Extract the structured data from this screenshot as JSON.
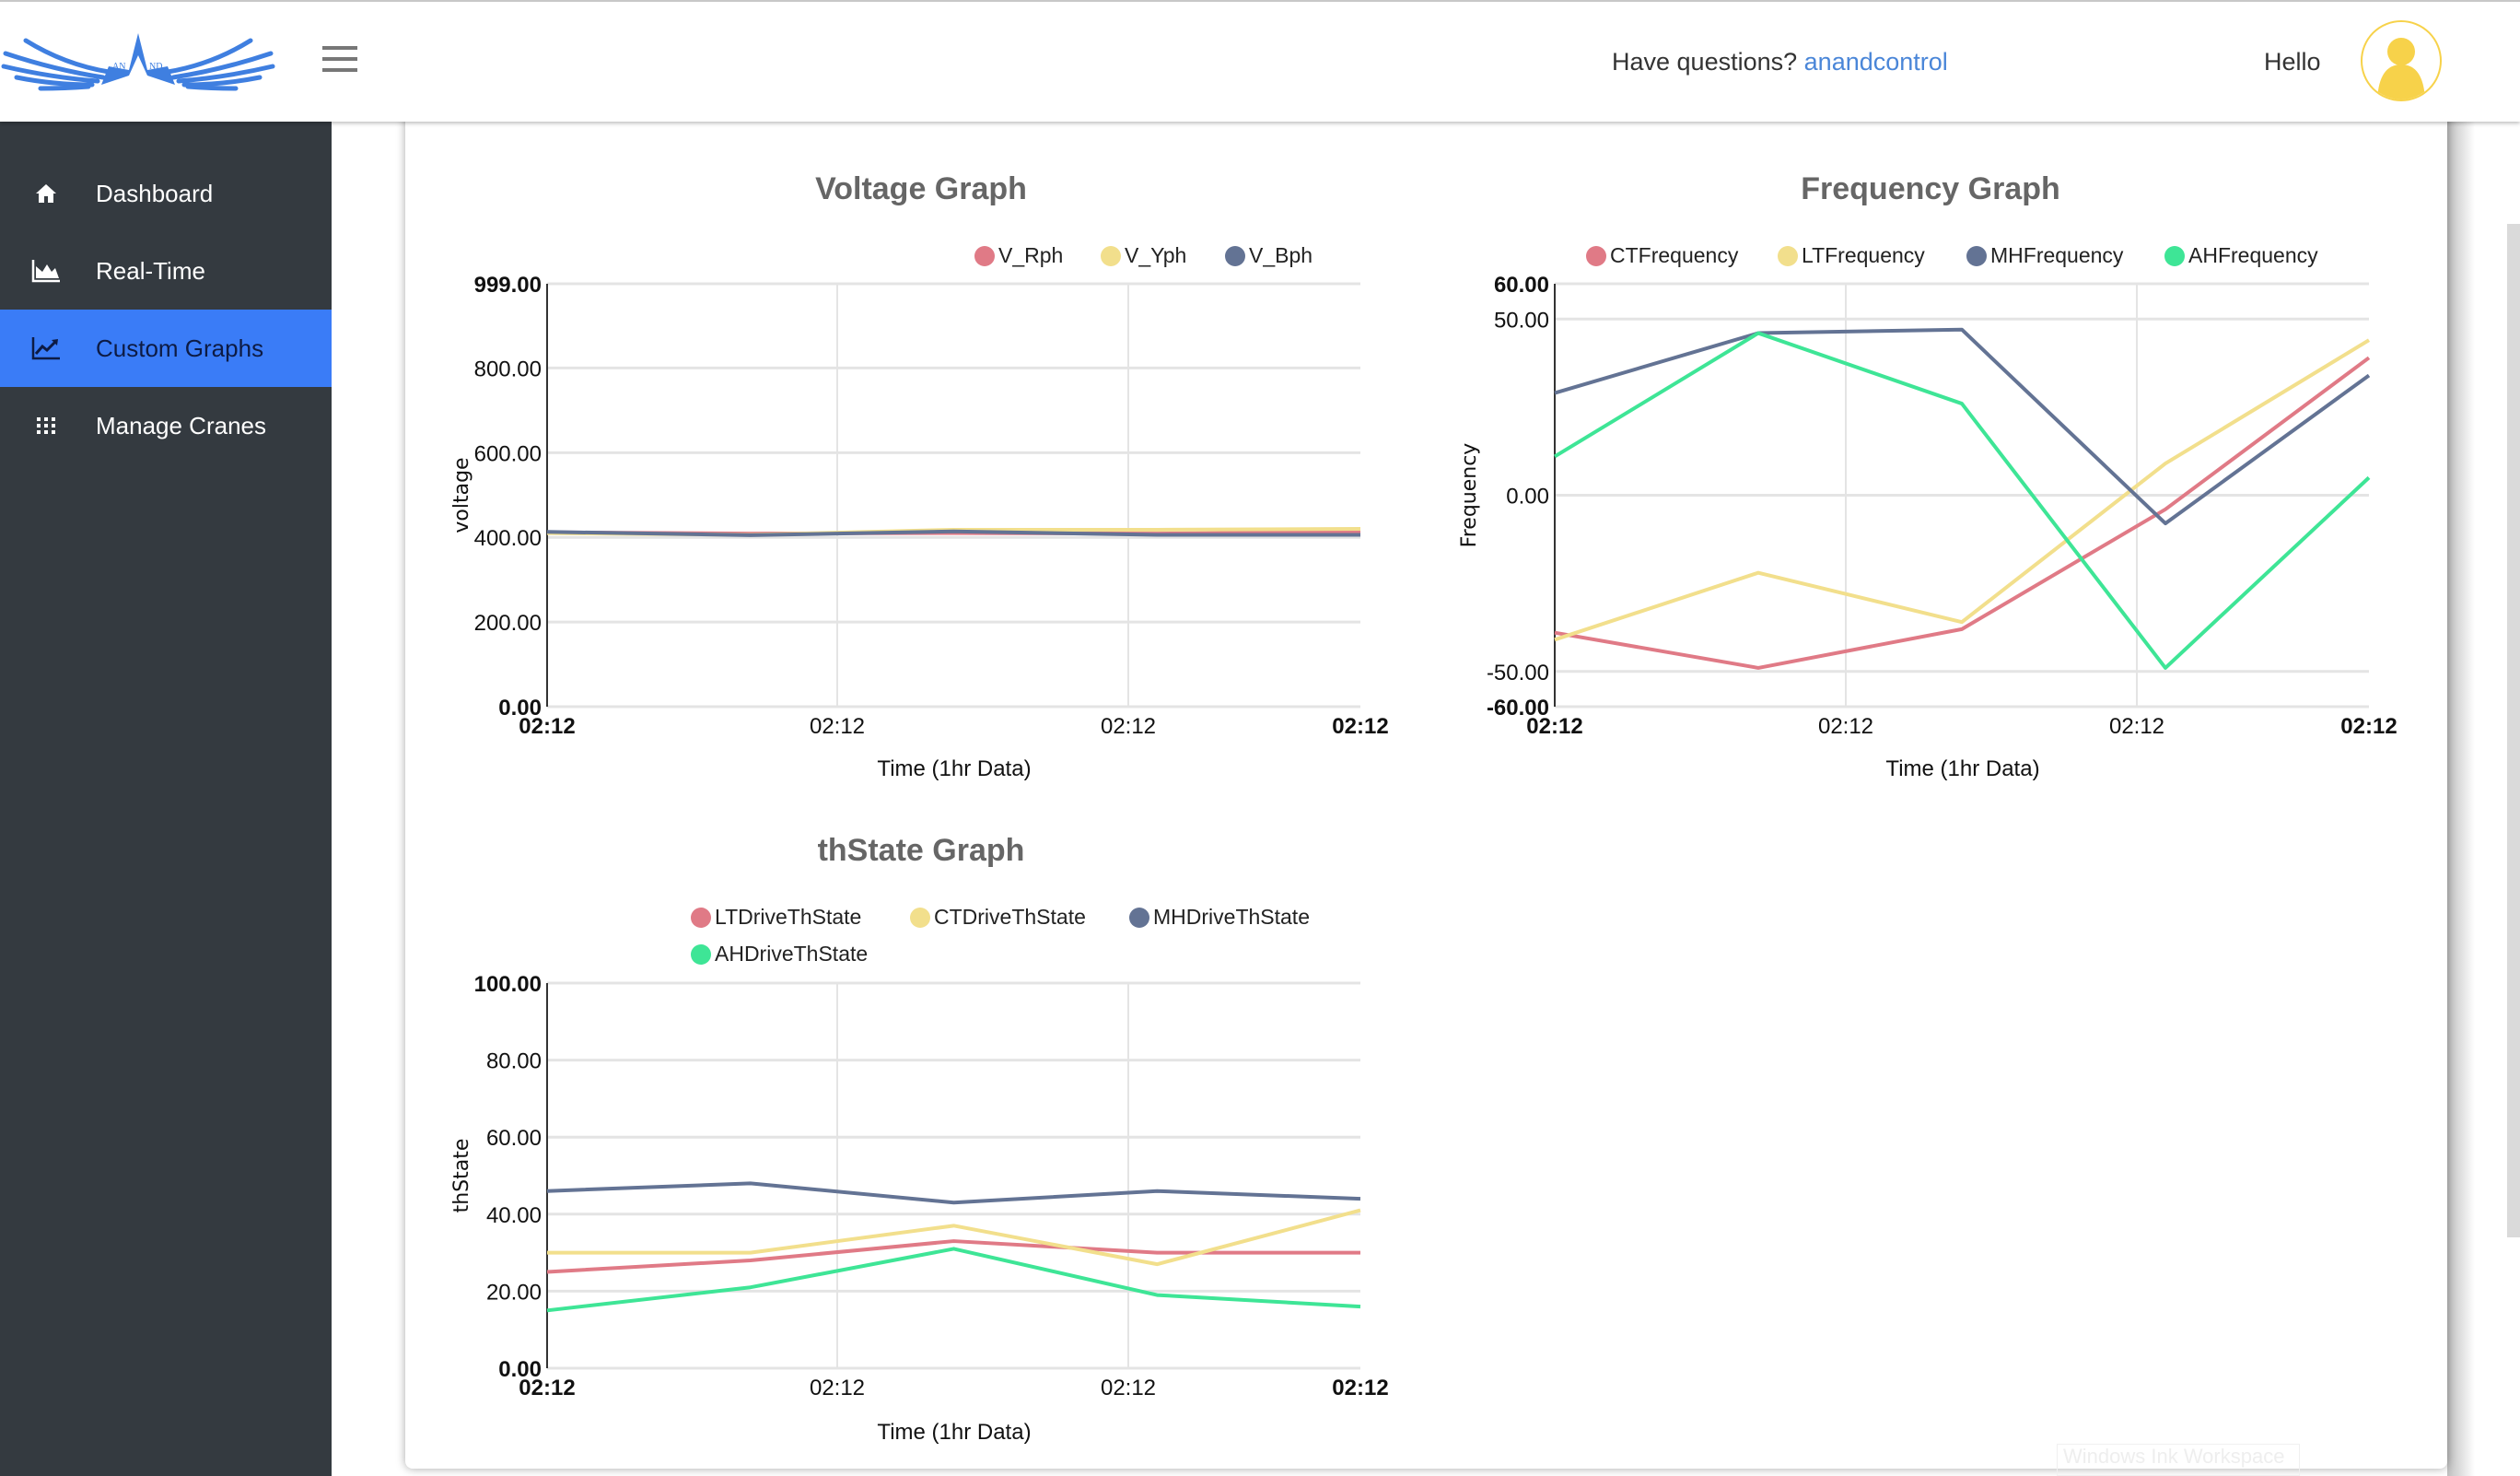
{
  "header": {
    "logo_alt": "anand logo",
    "logo_text_left": "AN",
    "logo_text_right": "ND",
    "questions_text": "Have questions?",
    "questions_link": "anandcontrol",
    "greeting": "Hello",
    "link_color": "#4a86d8",
    "avatar_color": "#f7d24a"
  },
  "sidebar": {
    "bg_color": "#343a40",
    "active_color": "#3a7cf7",
    "items": [
      {
        "label": "Dashboard",
        "icon": "home-icon",
        "active": false
      },
      {
        "label": "Real-Time",
        "icon": "area-chart-icon",
        "active": false
      },
      {
        "label": "Custom Graphs",
        "icon": "line-chart-icon",
        "active": true
      },
      {
        "label": "Manage Cranes",
        "icon": "grid-icon",
        "active": false
      }
    ]
  },
  "watermark": "Windows Ink Workspace",
  "chart_data": [
    {
      "type": "line",
      "title": "Voltage Graph",
      "xlabel": "Time (1hr Data)",
      "ylabel": "voltage",
      "x": [
        "02:12",
        "02:12",
        "02:12",
        "02:12",
        "02:12"
      ],
      "xticks": [
        "02:12",
        "02:12",
        "02:12",
        "02:12"
      ],
      "yticks": [
        "0.00",
        "200.00",
        "400.00",
        "600.00",
        "800.00",
        "999.00"
      ],
      "ylim": [
        0,
        999
      ],
      "grid": true,
      "legend_position": "top-right",
      "series": [
        {
          "name": "V_Rph",
          "color": "#e07a86",
          "values": [
            412,
            409,
            410,
            409,
            413
          ]
        },
        {
          "name": "V_Yph",
          "color": "#f2df8c",
          "values": [
            410,
            406,
            418,
            418,
            420
          ]
        },
        {
          "name": "V_Bph",
          "color": "#637394",
          "values": [
            413,
            405,
            414,
            406,
            406
          ]
        }
      ]
    },
    {
      "type": "line",
      "title": "Frequency Graph",
      "xlabel": "Time (1hr Data)",
      "ylabel": "Frequency",
      "x": [
        "02:12",
        "02:12",
        "02:12",
        "02:12",
        "02:12"
      ],
      "xticks": [
        "02:12",
        "02:12",
        "02:12",
        "02:12"
      ],
      "yticks": [
        "-60.00",
        "-50.00",
        "0.00",
        "50.00",
        "60.00"
      ],
      "ylim": [
        -60,
        60
      ],
      "grid": true,
      "legend_position": "top",
      "series": [
        {
          "name": "CTFrequency",
          "color": "#e07a86",
          "values": [
            -39,
            -49,
            -38,
            -4,
            39
          ]
        },
        {
          "name": "LTFrequency",
          "color": "#f2df8c",
          "values": [
            -41,
            -22,
            -36,
            9,
            44
          ]
        },
        {
          "name": "MHFrequency",
          "color": "#637394",
          "values": [
            29,
            46,
            47,
            -8,
            34
          ]
        },
        {
          "name": "AHFrequency",
          "color": "#3ee596",
          "values": [
            11,
            46,
            26,
            -49,
            5
          ]
        }
      ]
    },
    {
      "type": "line",
      "title": "thState Graph",
      "xlabel": "Time (1hr Data)",
      "ylabel": "thState",
      "x": [
        "02:12",
        "02:12",
        "02:12",
        "02:12",
        "02:12"
      ],
      "xticks": [
        "02:12",
        "02:12",
        "02:12",
        "02:12"
      ],
      "yticks": [
        "0.00",
        "20.00",
        "40.00",
        "60.00",
        "80.00",
        "100.00"
      ],
      "ylim": [
        0,
        100
      ],
      "grid": true,
      "legend_position": "top",
      "series": [
        {
          "name": "LTDriveThState",
          "color": "#e07a86",
          "values": [
            25,
            28,
            33,
            30,
            30
          ]
        },
        {
          "name": "CTDriveThState",
          "color": "#f2df8c",
          "values": [
            30,
            30,
            37,
            27,
            41
          ]
        },
        {
          "name": "MHDriveThState",
          "color": "#637394",
          "values": [
            46,
            48,
            43,
            46,
            44
          ]
        },
        {
          "name": "AHDriveThState",
          "color": "#3ee596",
          "values": [
            15,
            21,
            31,
            19,
            16
          ]
        }
      ]
    }
  ]
}
